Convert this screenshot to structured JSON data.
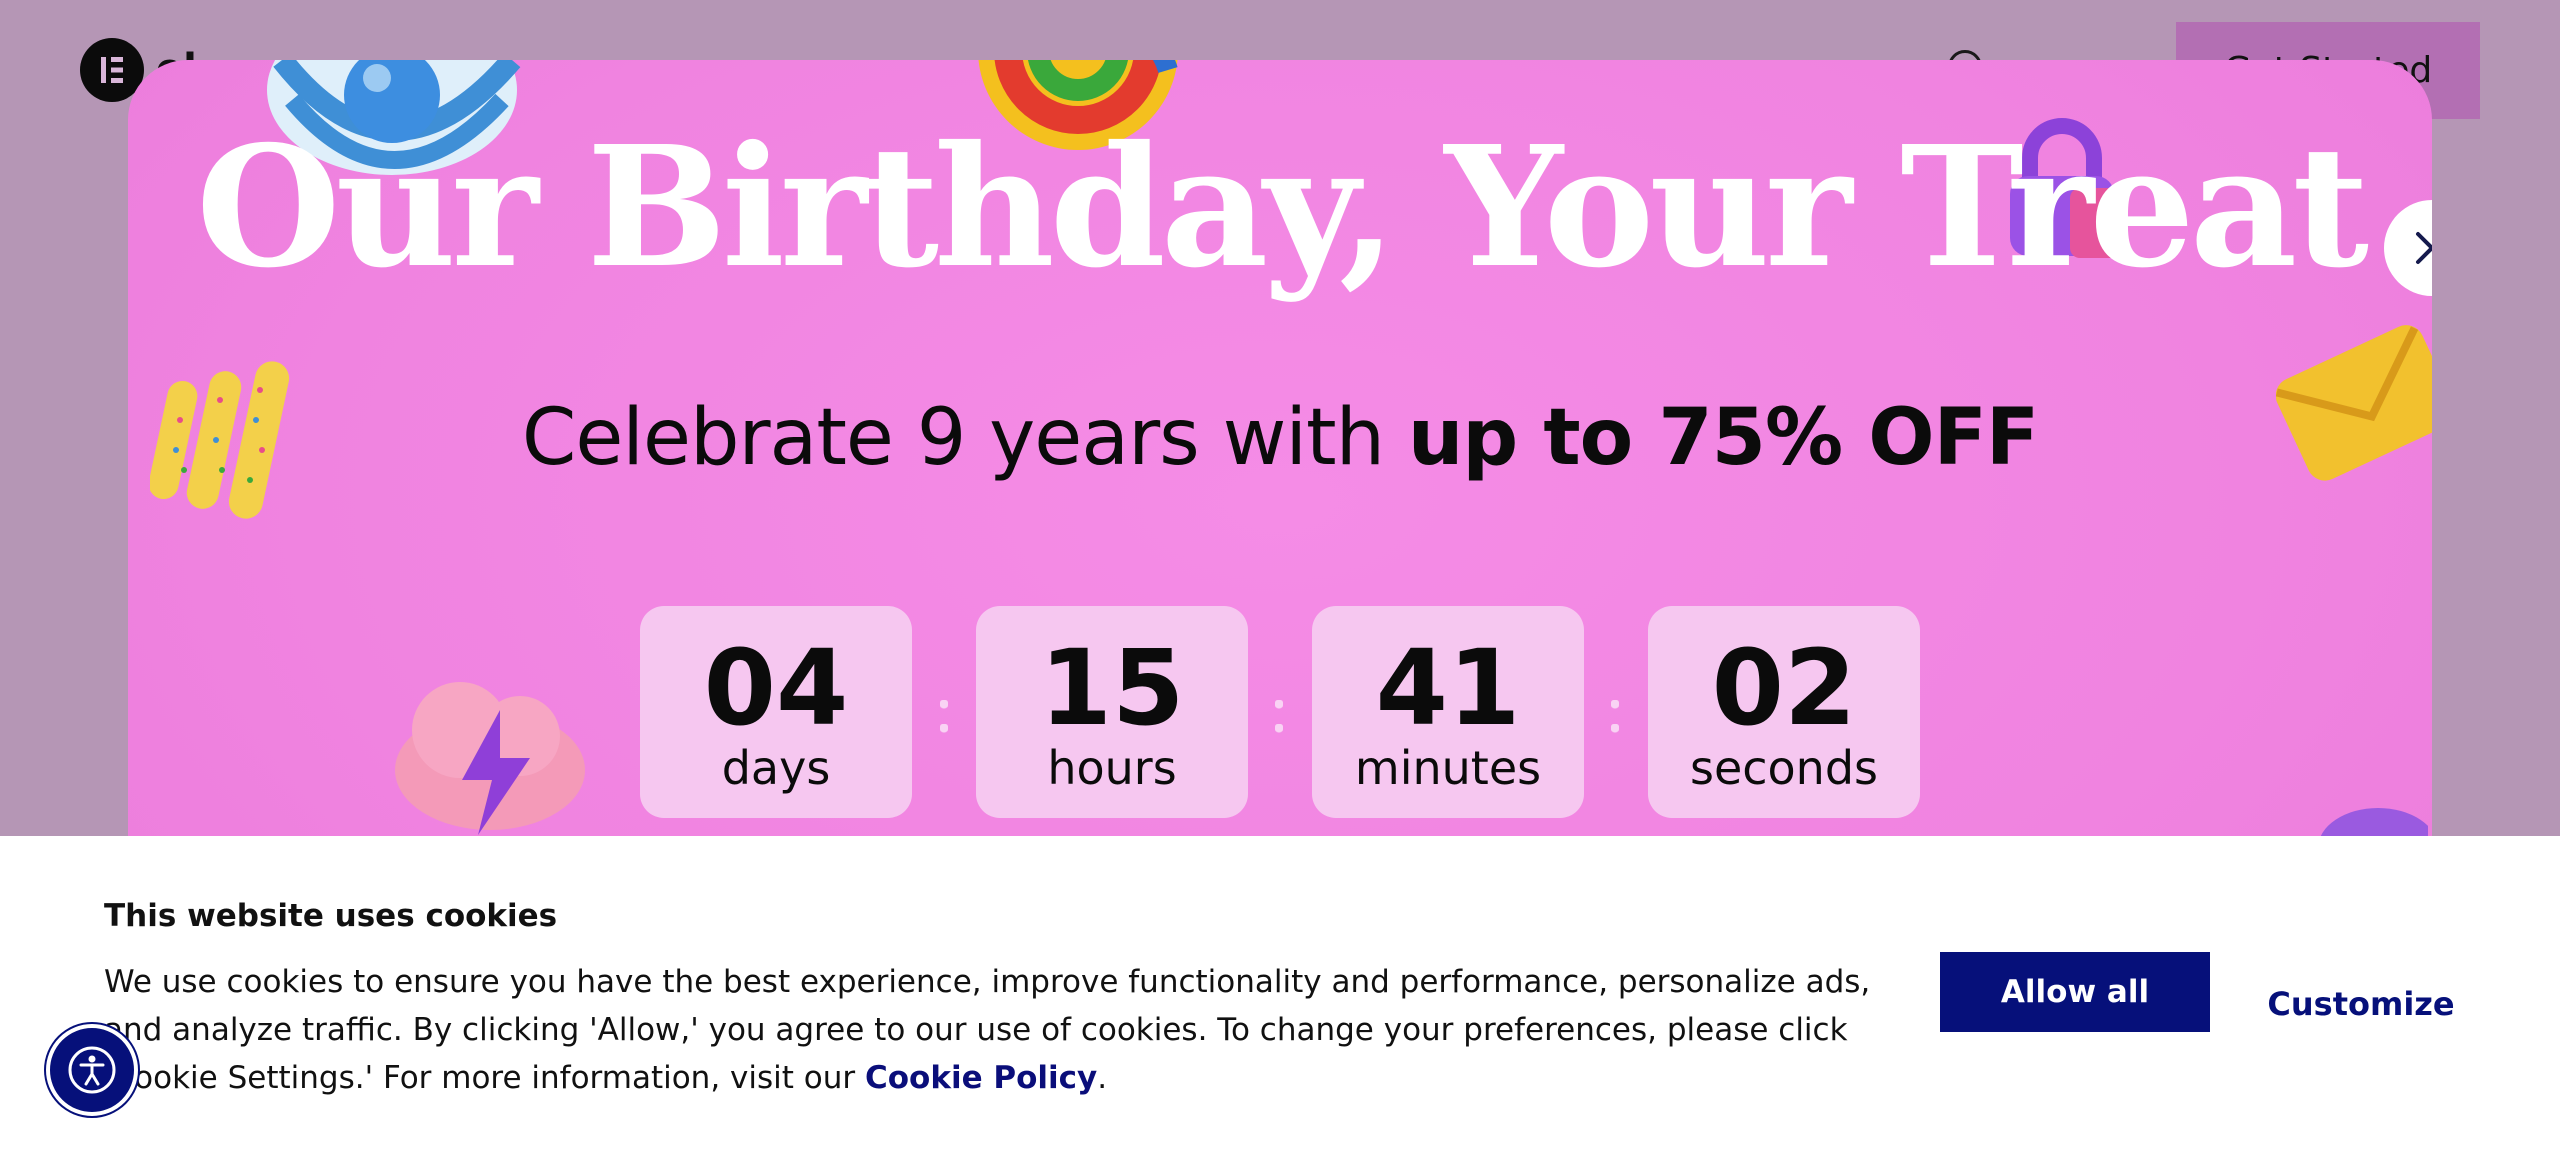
{
  "header": {
    "logo_icon": "elementor-logo-icon",
    "wordmark_partial": "el",
    "globe_icon": "globe-icon",
    "cta_label": "Get Started"
  },
  "promo": {
    "title": "Our Birthday, Your Treat",
    "subtitle_prefix": "Celebrate 9 years with ",
    "subtitle_bold": "up to 75% OFF",
    "close_icon": "close-icon",
    "countdown": [
      {
        "value": "04",
        "unit": "days"
      },
      {
        "value": "15",
        "unit": "hours"
      },
      {
        "value": "41",
        "unit": "minutes"
      },
      {
        "value": "02",
        "unit": "seconds"
      }
    ],
    "background_color": "#f083e0"
  },
  "cookie": {
    "title": "This website uses cookies",
    "text": "We use cookies to ensure you have the best experience, improve functionality and performance, personalize ads, and analyze traffic. By clicking 'Allow,' you agree to our use of cookies. To change your preferences, please click 'Cookie Settings.' For more information, visit our ",
    "link_label": "Cookie Policy",
    "text_end": ".",
    "allow_label": "Allow all",
    "customize_label": "Customize",
    "accent_color": "#06107a"
  },
  "accessibility": {
    "icon": "accessibility-icon"
  }
}
